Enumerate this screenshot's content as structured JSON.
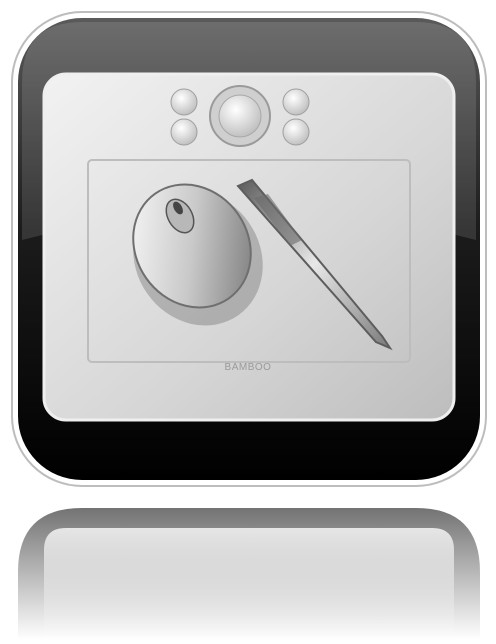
{
  "icon": {
    "name": "graphics-tablet-app-icon",
    "brand_label": "BAMBOO",
    "colors": {
      "frame_outer": "#0a0a0a",
      "frame_gloss": "#3a3a3a",
      "tablet_body": "#d9d9d9",
      "tablet_edge": "#f4f4f4",
      "active_area": "#d2d2d2",
      "pen_shadow": "#8c8c8c"
    },
    "express_keys": [
      {
        "label": ""
      },
      {
        "label": ""
      },
      {
        "label": ""
      },
      {
        "label": ""
      }
    ]
  }
}
